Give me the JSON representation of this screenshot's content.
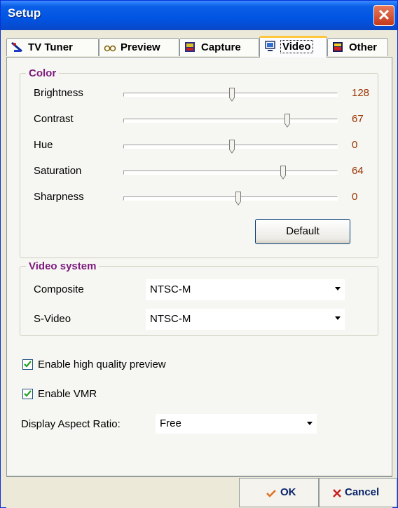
{
  "window": {
    "title": "Setup",
    "close_glyph": "✕"
  },
  "tabs": [
    {
      "label": "TV Tuner",
      "icon": "tv-tuner-icon"
    },
    {
      "label": "Preview",
      "icon": "glasses-icon"
    },
    {
      "label": "Capture",
      "icon": "capture-icon"
    },
    {
      "label": "Video",
      "icon": "monitor-icon",
      "active": true
    },
    {
      "label": "Other",
      "icon": "other-icon"
    }
  ],
  "color": {
    "title": "Color",
    "sliders": [
      {
        "label": "Brightness",
        "value": "128",
        "fraction": 0.51
      },
      {
        "label": "Contrast",
        "value": "67",
        "fraction": 0.77
      },
      {
        "label": "Hue",
        "value": "0",
        "fraction": 0.51
      },
      {
        "label": "Saturation",
        "value": "64",
        "fraction": 0.75
      },
      {
        "label": "Sharpness",
        "value": "0",
        "fraction": 0.54
      }
    ],
    "default_label": "Default"
  },
  "video_system": {
    "title": "Video system",
    "composite": {
      "label": "Composite",
      "value": "NTSC-M"
    },
    "svideo": {
      "label": "S-Video",
      "value": "NTSC-M"
    }
  },
  "options": {
    "hq_preview": {
      "label": "Enable high quality preview",
      "checked": true
    },
    "vmr": {
      "label": "Enable VMR",
      "checked": true
    }
  },
  "aspect": {
    "label": "Display Aspect Ratio:",
    "value": "Free"
  },
  "buttons": {
    "ok": "OK",
    "cancel": "Cancel"
  },
  "colors": {
    "accent_title": "#7d1b7e",
    "value_text": "#993300",
    "titlebar": "#0054e3",
    "active_tab_top": "#ffc83c"
  }
}
